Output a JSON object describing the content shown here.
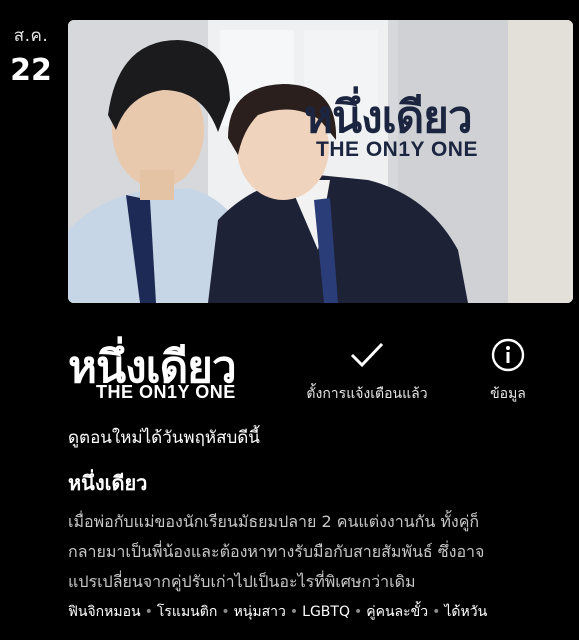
{
  "date": {
    "month": "ส.ค.",
    "day": "22"
  },
  "poster": {
    "title_th": "หนึ่งเดียว",
    "title_en": "THE ON1Y ONE"
  },
  "logo": {
    "title_th": "หนึ่งเดียว",
    "title_en": "THE ON1Y ONE"
  },
  "actions": {
    "remind": {
      "label": "ตั้งการแจ้งเตือนแล้ว",
      "icon": "checkmark-icon"
    },
    "info": {
      "label": "ข้อมูล",
      "icon": "info-icon"
    }
  },
  "tagline": "ดูตอนใหม่ได้วันพฤหัสบดีนี้",
  "show_title": "หนึ่งเดียว",
  "synopsis": [
    "เมื่อพ่อกับแม่ของนักเรียนมัธยมปลาย 2 คนแต่งงานกัน ทั้งคู่ก็",
    "กลายมาเป็นพี่น้องและต้องหาทางรับมือกับสายสัมพันธ์ ซึ่งอาจ",
    "แปรเปลี่ยนจากคู่ปรับเก่าไปเป็นอะไรที่พิเศษกว่าเดิม"
  ],
  "genres": [
    "ฟินจิกหมอน",
    "โรแมนติก",
    "หนุ่มสาว",
    "LGBTQ",
    "คู่คนละขั้ว",
    "ได้หวัน"
  ]
}
